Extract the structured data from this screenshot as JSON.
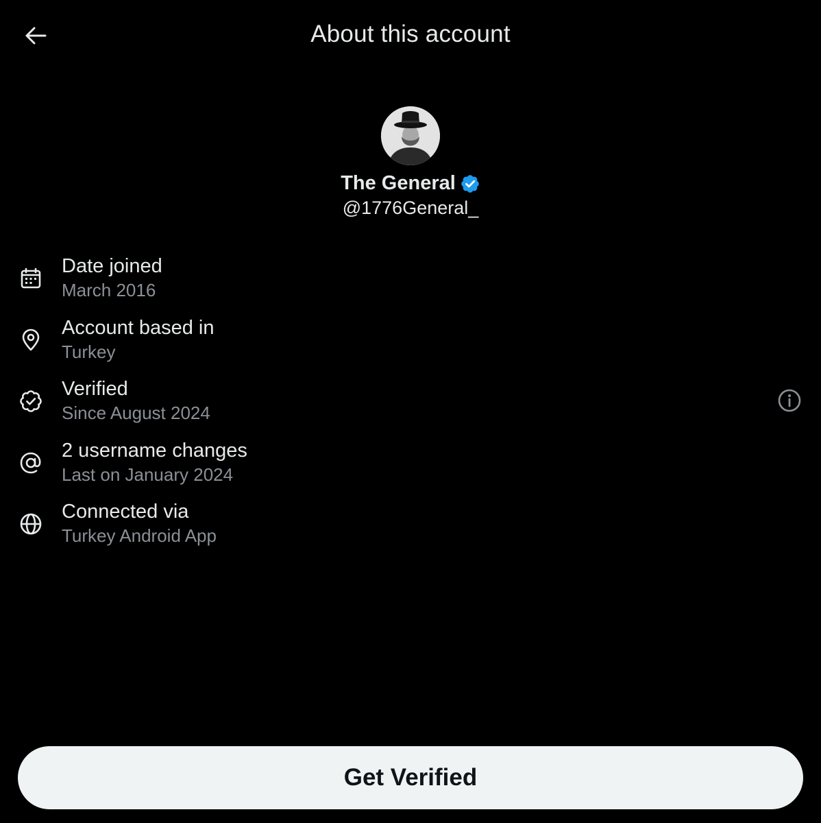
{
  "header": {
    "title": "About this account",
    "back_icon": "arrow-left-icon"
  },
  "profile": {
    "display_name": "The General",
    "handle": "@1776General_",
    "verified": true,
    "badge_color": "#1d9bf0"
  },
  "rows": [
    {
      "icon": "calendar-icon",
      "title": "Date joined",
      "subtitle": "March 2016"
    },
    {
      "icon": "location-pin-icon",
      "title": "Account based in",
      "subtitle": "Turkey"
    },
    {
      "icon": "verified-check-icon",
      "title": "Verified",
      "subtitle": "Since August 2024",
      "info_icon": "info-icon"
    },
    {
      "icon": "at-sign-icon",
      "title": "2 username changes",
      "subtitle": "Last on January 2024"
    },
    {
      "icon": "globe-icon",
      "title": "Connected via",
      "subtitle": "Turkey Android App"
    }
  ],
  "cta": {
    "label": "Get Verified"
  },
  "colors": {
    "background": "#000000",
    "primary_text": "#e7e9ea",
    "secondary_text": "#8b9096",
    "button_bg": "#eff3f4",
    "button_text": "#0f1419"
  }
}
